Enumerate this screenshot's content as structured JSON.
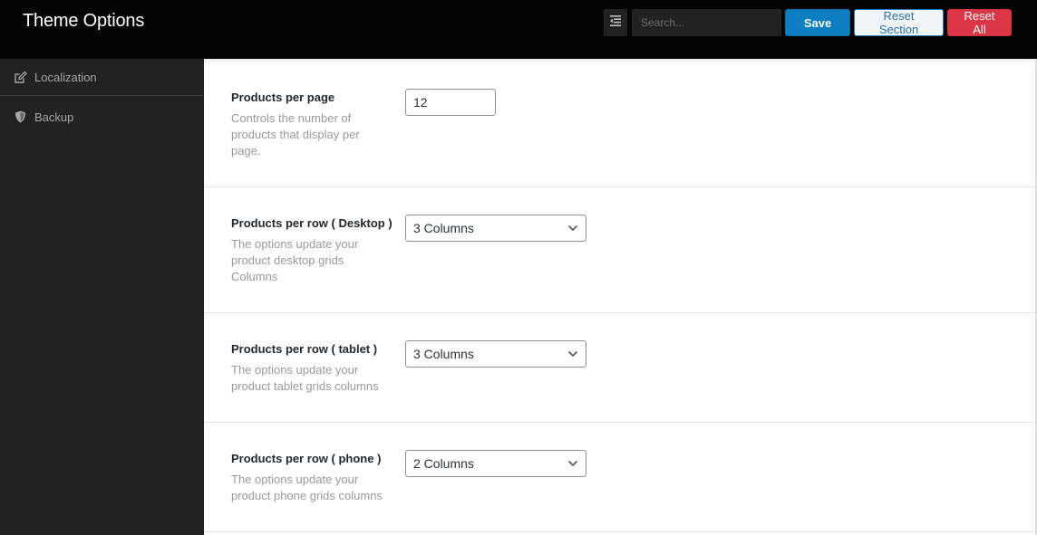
{
  "header": {
    "title": "Theme Options",
    "search_placeholder": "Search...",
    "buttons": {
      "expand_icon": "expand-menu-icon",
      "save": "Save",
      "reset_section": "Reset Section",
      "reset_all": "Reset All"
    },
    "colors": {
      "save": "#0c7ec1",
      "reset_section_text": "#2872a8",
      "reset_all": "#dc3545"
    }
  },
  "sidebar": {
    "items": [
      {
        "label": "Localization",
        "icon": "edit-icon"
      },
      {
        "label": "Backup",
        "icon": "shield-icon"
      }
    ]
  },
  "settings": [
    {
      "title": "Products per page",
      "description": "Controls the number of products that display per page.",
      "type": "text",
      "value": "12"
    },
    {
      "title": "Products per row ( Desktop )",
      "description": "The options update your product desktop grids Columns",
      "type": "select",
      "value": "3 Columns"
    },
    {
      "title": "Products per row ( tablet )",
      "description": "The options update your product tablet grids columns",
      "type": "select",
      "value": "3 Columns"
    },
    {
      "title": "Products per row ( phone )",
      "description": "The options update your product phone grids columns",
      "type": "select",
      "value": "2 Columns"
    }
  ]
}
